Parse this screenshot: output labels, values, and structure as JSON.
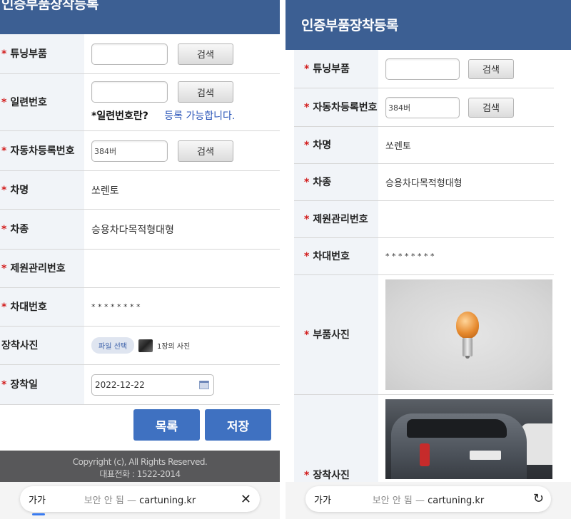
{
  "left": {
    "header_title": "인증부품장착등록",
    "rows": {
      "tuning_part": {
        "label": "튜닝부품",
        "search_label": "검색"
      },
      "serial": {
        "label": "일련번호",
        "search_label": "검색",
        "note_question": "*일련번호란?",
        "note_status": "등록 가능합니다."
      },
      "car_reg": {
        "label": "자동차등록번호",
        "value": "384버",
        "search_label": "검색"
      },
      "car_name": {
        "label": "차명",
        "value": "쏘렌토"
      },
      "car_type": {
        "label": "차종",
        "value": "승용차다목적형대형"
      },
      "spec_no": {
        "label": "제원관리번호"
      },
      "chassis": {
        "label": "차대번호",
        "value": "* * * * * * * *"
      },
      "photo": {
        "label": "장착사진",
        "file_button": "파일 선택",
        "file_text": "1장의 사진"
      },
      "date": {
        "label": "장착일",
        "value": "2022-12-22"
      }
    },
    "buttons": {
      "list": "목록",
      "save": "저장"
    },
    "footer": {
      "copyright": "Copyright (c), All Rights Reserved.",
      "phone": "대표전화 : 1522-2014"
    }
  },
  "right": {
    "header_title": "인증부품장착등록",
    "rows": {
      "tuning_part": {
        "label": "튜닝부품",
        "search_label": "검색"
      },
      "car_reg": {
        "label": "자동차등록번호",
        "value": "384버",
        "search_label": "검색"
      },
      "car_name": {
        "label": "차명",
        "value": "쏘렌토"
      },
      "car_type": {
        "label": "차종",
        "value": "승용차다목적형대형"
      },
      "spec_no": {
        "label": "제원관리번호"
      },
      "chassis": {
        "label": "차대번호",
        "value": "* * * * * * * *"
      },
      "part_photo": {
        "label": "부품사진"
      },
      "install_photo": {
        "label": "장착사진"
      }
    }
  },
  "browser": {
    "text_size_label": "가가",
    "insecure_label": "보안 안 됨 —",
    "domain": "cartuning.kr",
    "left_action_icon": "close-icon",
    "right_action_icon": "reload-icon"
  },
  "colors": {
    "header": "#3c5f93",
    "primary_button": "#3f71c1",
    "required": "#d21c1c",
    "link": "#2a55b8"
  }
}
